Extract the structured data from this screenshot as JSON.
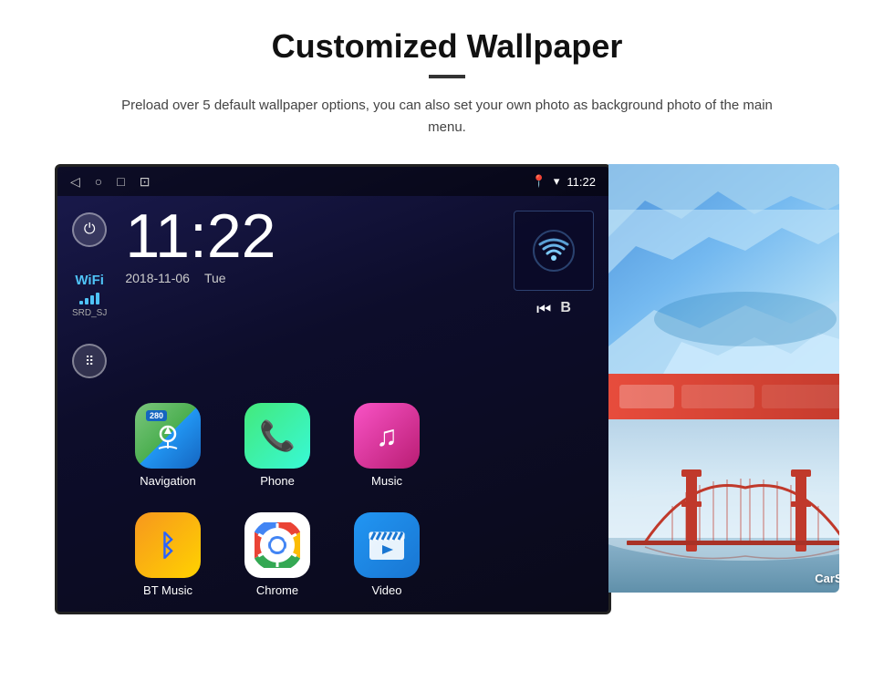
{
  "page": {
    "title": "Customized Wallpaper",
    "subtitle": "Preload over 5 default wallpaper options, you can also set your own photo as background photo of the main menu."
  },
  "status_bar": {
    "time": "11:22",
    "nav_back": "◁",
    "nav_home": "○",
    "nav_recent": "□",
    "nav_screenshot": "⊞",
    "location_icon": "◆",
    "wifi_icon": "▾",
    "signal_icon": "▲"
  },
  "clock": {
    "time": "11:22",
    "date": "2018-11-06",
    "day": "Tue"
  },
  "wifi": {
    "label": "WiFi",
    "network": "SRD_SJ"
  },
  "apps": [
    {
      "id": "navigation",
      "label": "Navigation",
      "badge": "280"
    },
    {
      "id": "phone",
      "label": "Phone"
    },
    {
      "id": "music",
      "label": "Music"
    },
    {
      "id": "bt-music",
      "label": "BT Music"
    },
    {
      "id": "chrome",
      "label": "Chrome"
    },
    {
      "id": "video",
      "label": "Video"
    }
  ],
  "wallpapers": [
    {
      "id": "ice",
      "type": "ice-landscape"
    },
    {
      "id": "carsetting",
      "label": "CarSetting"
    },
    {
      "id": "bridge",
      "type": "golden-gate"
    }
  ]
}
